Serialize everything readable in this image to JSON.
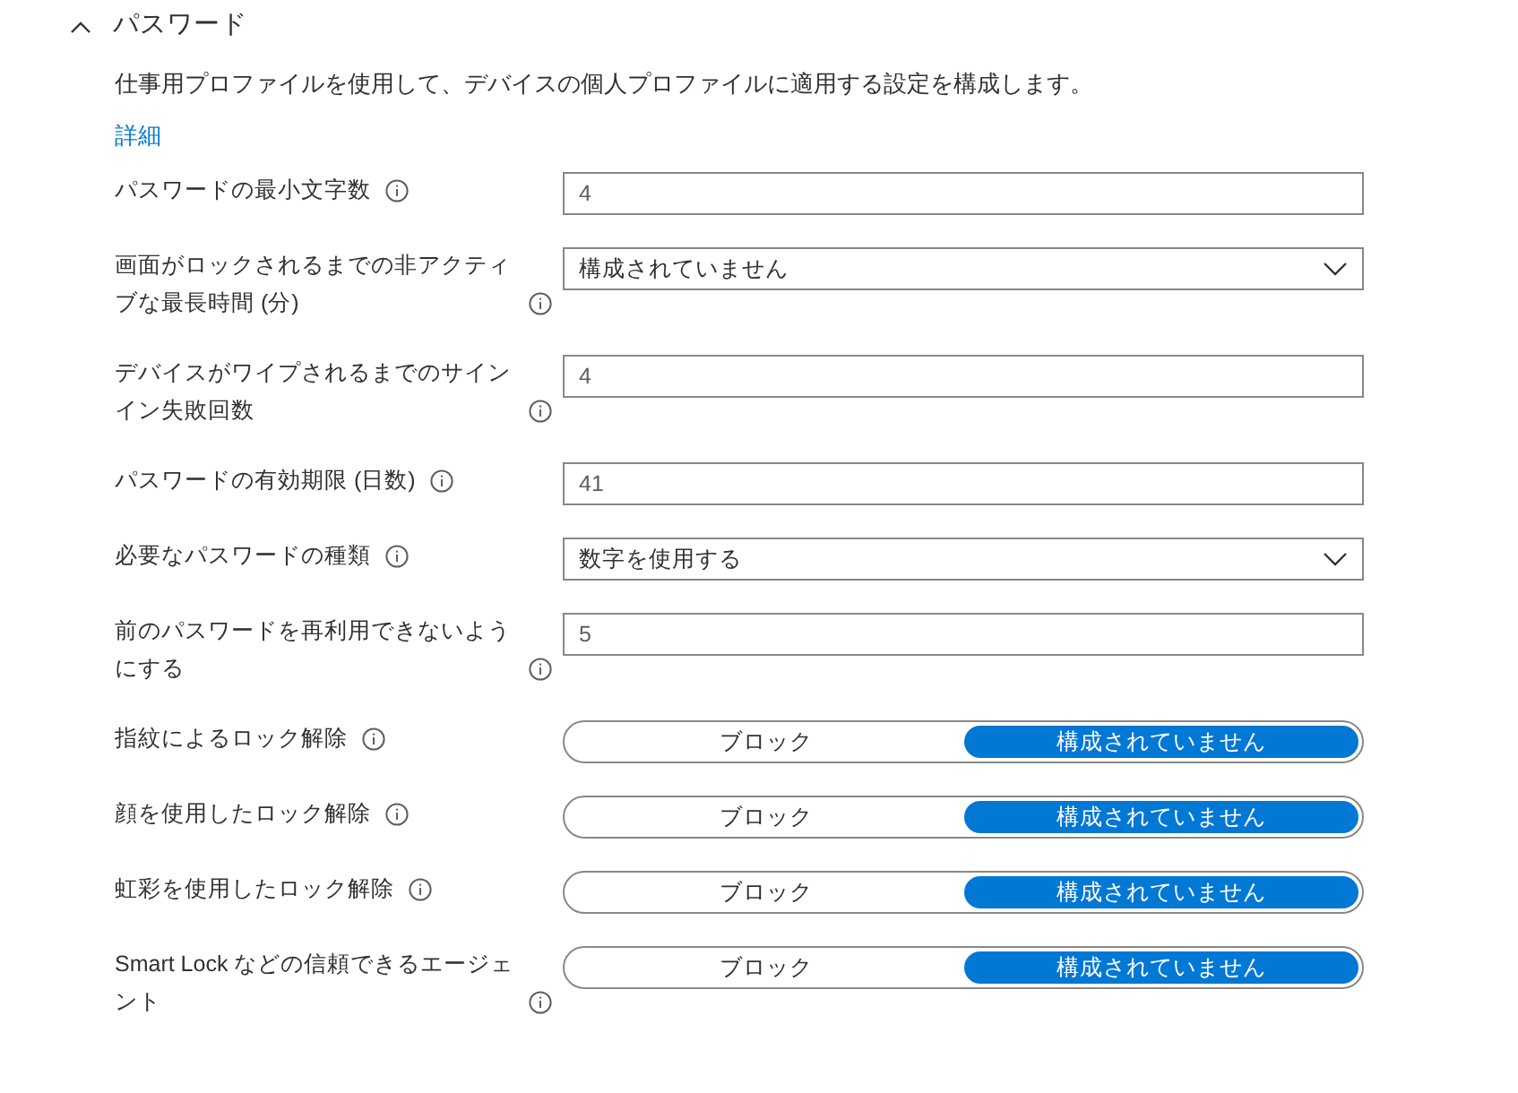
{
  "section": {
    "title": "パスワード",
    "expanded": true,
    "description": "仕事用プロファイルを使用して、デバイスの個人プロファイルに適用する設定を構成します。",
    "link": "詳細"
  },
  "settings": [
    {
      "label": "パスワードの最小文字数",
      "kind": "text",
      "value": "4"
    },
    {
      "label": "画面がロックされるまでの非アクティブな最長時間 (分)",
      "kind": "dropdown",
      "value": "構成されていません"
    },
    {
      "label": "デバイスがワイプされるまでのサインイン失敗回数",
      "kind": "text",
      "value": "4"
    },
    {
      "label": "パスワードの有効期限 (日数)",
      "kind": "text",
      "value": "41"
    },
    {
      "label": "必要なパスワードの種類",
      "kind": "dropdown",
      "value": "数字を使用する"
    },
    {
      "label": "前のパスワードを再利用できないようにする",
      "kind": "text",
      "value": "5"
    },
    {
      "label": "指紋によるロック解除",
      "kind": "toggle",
      "options": [
        {
          "label": "ブロック",
          "selected": false
        },
        {
          "label": "構成されていません",
          "selected": true
        }
      ]
    },
    {
      "label": "顔を使用したロック解除",
      "kind": "toggle",
      "options": [
        {
          "label": "ブロック",
          "selected": false
        },
        {
          "label": "構成されていません",
          "selected": true
        }
      ]
    },
    {
      "label": "虹彩を使用したロック解除",
      "kind": "toggle",
      "options": [
        {
          "label": "ブロック",
          "selected": false
        },
        {
          "label": "構成されていません",
          "selected": true
        }
      ]
    },
    {
      "label": "Smart Lock などの信頼できるエージェント",
      "kind": "toggle",
      "options": [
        {
          "label": "ブロック",
          "selected": false
        },
        {
          "label": "構成されていません",
          "selected": true
        }
      ]
    }
  ]
}
